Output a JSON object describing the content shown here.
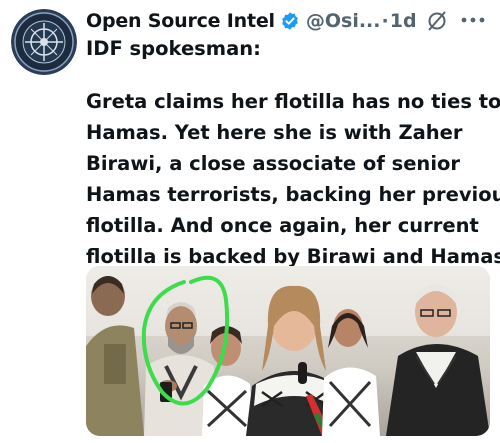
{
  "author": {
    "name": "Open Source Intel",
    "handle": "@Osi...",
    "separator": "·",
    "time": "1d"
  },
  "tweet": {
    "first_line": "IDF spokesman:",
    "lines": [
      "Greta claims her flotilla has no ties to",
      "Hamas. Yet here she is with Zaher",
      "Birawi, a close associate of senior",
      "Hamas terrorists, backing her previous",
      "flotilla. And once again, her current",
      "flotilla is backed by Birawi and Hamas."
    ]
  },
  "icons": {
    "avatar": "avatar-logo",
    "verified": "verified-badge-icon",
    "grok": "grok-icon",
    "more": "more-icon"
  },
  "colors": {
    "verified_blue": "#1d9bf0",
    "text": "#0f1419",
    "secondary": "#536471",
    "circle_annotation": "#3ddc4a"
  }
}
